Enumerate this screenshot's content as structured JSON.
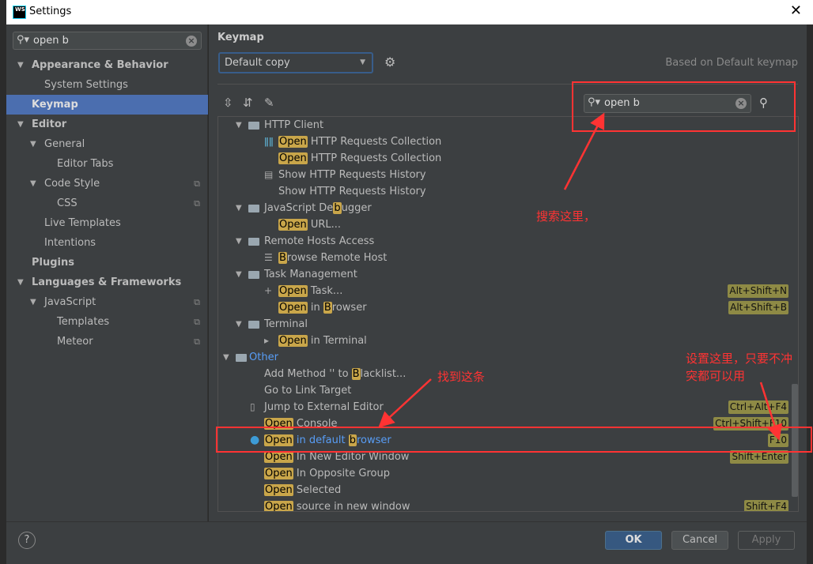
{
  "window": {
    "title": "Settings",
    "logo": "WS",
    "close_icon": "✕"
  },
  "sidebar": {
    "search_value": "open b",
    "items": [
      {
        "label": "Appearance & Behavior",
        "level": 0,
        "bold": true,
        "arrow": true
      },
      {
        "label": "System Settings",
        "level": 1
      },
      {
        "label": "Keymap",
        "level": 0,
        "bold": true,
        "selected": true
      },
      {
        "label": "Editor",
        "level": 0,
        "bold": true,
        "arrow": true
      },
      {
        "label": "General",
        "level": 1,
        "arrow": true
      },
      {
        "label": "Editor Tabs",
        "level": 2
      },
      {
        "label": "Code Style",
        "level": 1,
        "arrow": true,
        "copy": true
      },
      {
        "label": "CSS",
        "level": 2,
        "copy": true
      },
      {
        "label": "Live Templates",
        "level": 1
      },
      {
        "label": "Intentions",
        "level": 1
      },
      {
        "label": "Plugins",
        "level": 0,
        "bold": true
      },
      {
        "label": "Languages & Frameworks",
        "level": 0,
        "bold": true,
        "arrow": true
      },
      {
        "label": "JavaScript",
        "level": 1,
        "arrow": true,
        "copy": true
      },
      {
        "label": "Templates",
        "level": 2,
        "copy": true
      },
      {
        "label": "Meteor",
        "level": 2,
        "copy": true
      }
    ]
  },
  "keymap": {
    "heading": "Keymap",
    "scheme": "Default copy",
    "based_on": "Based on Default keymap",
    "search_value": "open b"
  },
  "tree": [
    {
      "kind": "group",
      "level": 1,
      "segs": [
        [
          "HTTP Client",
          0
        ]
      ]
    },
    {
      "kind": "action",
      "level": 2,
      "icon": "bars-icon",
      "segs": [
        [
          "Open",
          1
        ],
        [
          " HTTP Requests Collection",
          0
        ]
      ]
    },
    {
      "kind": "action",
      "level": 2,
      "segs": [
        [
          "Open",
          1
        ],
        [
          " HTTP Requests Collection",
          0
        ]
      ]
    },
    {
      "kind": "action",
      "level": 2,
      "icon": "history-icon",
      "segs": [
        [
          "Show HTTP Requests History",
          0
        ]
      ]
    },
    {
      "kind": "action",
      "level": 2,
      "segs": [
        [
          "Show HTTP Requests History",
          0
        ]
      ]
    },
    {
      "kind": "group",
      "level": 1,
      "segs": [
        [
          "JavaScript De",
          0
        ],
        [
          "b",
          1
        ],
        [
          "ugger",
          0
        ]
      ]
    },
    {
      "kind": "action",
      "level": 2,
      "segs": [
        [
          "Open",
          1
        ],
        [
          " URL...",
          0
        ]
      ]
    },
    {
      "kind": "group",
      "level": 1,
      "segs": [
        [
          "Remote Hosts Access",
          0
        ]
      ]
    },
    {
      "kind": "action",
      "level": 2,
      "icon": "server-icon",
      "segs": [
        [
          "B",
          1
        ],
        [
          "rowse Remote Host",
          0
        ]
      ]
    },
    {
      "kind": "group",
      "level": 1,
      "segs": [
        [
          "Task Management",
          0
        ]
      ]
    },
    {
      "kind": "action",
      "level": 2,
      "icon": "plus-icon",
      "segs": [
        [
          "Open",
          1
        ],
        [
          " Task...",
          0
        ]
      ],
      "shortcut": "Alt+Shift+N"
    },
    {
      "kind": "action",
      "level": 2,
      "segs": [
        [
          "Open",
          1
        ],
        [
          " in ",
          0
        ],
        [
          "B",
          1
        ],
        [
          "rowser",
          0
        ]
      ],
      "shortcut": "Alt+Shift+B"
    },
    {
      "kind": "group",
      "level": 1,
      "segs": [
        [
          "Terminal",
          0
        ]
      ]
    },
    {
      "kind": "action",
      "level": 2,
      "icon": "terminal-icon",
      "segs": [
        [
          "Open",
          1
        ],
        [
          " in Terminal",
          0
        ]
      ]
    },
    {
      "kind": "group",
      "level": 0,
      "blue": true,
      "segs": [
        [
          "Other",
          0
        ]
      ]
    },
    {
      "kind": "action",
      "level": 1,
      "segs": [
        [
          "Add Method '' to ",
          0
        ],
        [
          "B",
          1
        ],
        [
          "lacklist...",
          0
        ]
      ]
    },
    {
      "kind": "action",
      "level": 1,
      "segs": [
        [
          "Go to Link Target",
          0
        ]
      ]
    },
    {
      "kind": "action",
      "level": 1,
      "icon": "external-editor-icon",
      "segs": [
        [
          "Jump to External Editor",
          0
        ]
      ],
      "shortcut": "Ctrl+Alt+F4"
    },
    {
      "kind": "action",
      "level": 1,
      "segs": [
        [
          "Open",
          1
        ],
        [
          " Console",
          0
        ]
      ],
      "shortcut": "Ctrl+Shift+F10"
    },
    {
      "kind": "action",
      "level": 1,
      "icon": "globe-icon",
      "blue": true,
      "segs": [
        [
          "Open",
          1
        ],
        [
          " in default ",
          0
        ],
        [
          "b",
          1
        ],
        [
          "rowser",
          0
        ]
      ],
      "shortcut": "F10"
    },
    {
      "kind": "action",
      "level": 1,
      "segs": [
        [
          "Open",
          1
        ],
        [
          " In New Editor Window",
          0
        ]
      ],
      "shortcut": "Shift+Enter"
    },
    {
      "kind": "action",
      "level": 1,
      "segs": [
        [
          "Open",
          1
        ],
        [
          " In Opposite Group",
          0
        ]
      ]
    },
    {
      "kind": "action",
      "level": 1,
      "segs": [
        [
          "Open",
          1
        ],
        [
          " Selected",
          0
        ]
      ]
    },
    {
      "kind": "action",
      "level": 1,
      "segs": [
        [
          "Open",
          1
        ],
        [
          " source in new window",
          0
        ]
      ],
      "shortcut": "Shift+F4"
    }
  ],
  "buttons": {
    "ok": "OK",
    "cancel": "Cancel",
    "apply": "Apply",
    "help": "?"
  },
  "annotations": {
    "search_here": "搜索这里，",
    "find_this": "找到这条",
    "set_here_1": "设置这里，只要不冲",
    "set_here_2": "突都可以用",
    "color": "#ff3333"
  }
}
